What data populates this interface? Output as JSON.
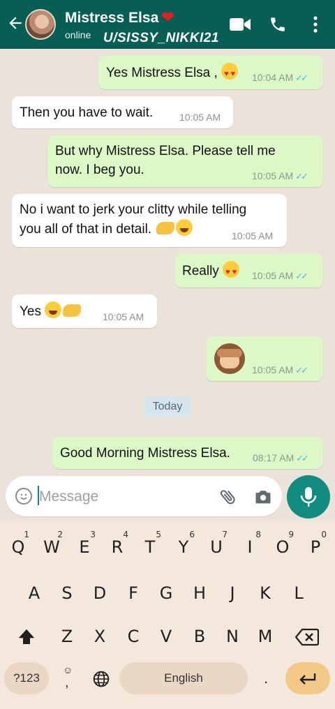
{
  "header": {
    "contact_name": "Mistress Elsa",
    "heart": "❤",
    "status": "online",
    "overlay_text": "U/SISSY_NIKKI21",
    "icons": [
      "back-arrow-icon",
      "avatar",
      "video-call-icon",
      "phone-icon",
      "more-options-icon"
    ]
  },
  "messages": [
    {
      "dir": "out",
      "text": "Yes Mistress Elsa ,",
      "emoji": "heart-eyes",
      "time": "10:04 AM"
    },
    {
      "dir": "in",
      "text": "Then you have to wait.",
      "time": "10:05 AM"
    },
    {
      "dir": "out",
      "line1": "But why Mistress Elsa. Please tell me",
      "line2": "now. I beg you.",
      "time": "10:05 AM"
    },
    {
      "dir": "in",
      "line1": "No i want to jerk your clitty while telling",
      "line2": "you all of that in detail.",
      "emoji": "pinching-hand, laughing",
      "time": "10:05 AM"
    },
    {
      "dir": "out",
      "text": "Really",
      "emoji": "heart-eyes",
      "time": "10:05 AM"
    },
    {
      "dir": "in",
      "text": "Yes",
      "emoji": "laughing, pinching-hand",
      "time": "10:05 AM"
    },
    {
      "dir": "out",
      "text": "",
      "emoji": "see-no-evil-monkey",
      "time": "10:05 AM"
    },
    {
      "dir": "out",
      "text": "Good Morning Mistress Elsa.",
      "time": "08:17 AM"
    }
  ],
  "date_divider": "Today",
  "composer": {
    "placeholder": "Message",
    "icons": [
      "emoji-icon",
      "attach-icon",
      "camera-icon",
      "mic-icon"
    ]
  },
  "keyboard": {
    "row1": [
      "Q",
      "W",
      "E",
      "R",
      "T",
      "Y",
      "U",
      "I",
      "O",
      "P"
    ],
    "row1_hints": [
      "1",
      "2",
      "3",
      "4",
      "5",
      "6",
      "7",
      "8",
      "9",
      "0"
    ],
    "row2": [
      "A",
      "S",
      "D",
      "F",
      "G",
      "H",
      "J",
      "K",
      "L"
    ],
    "row3": [
      "Z",
      "X",
      "C",
      "V",
      "B",
      "N",
      "M"
    ],
    "symbols_key": "?123",
    "comma_key": ",",
    "space_label": "English",
    "period_key": ".",
    "colors": {
      "enter_key": "#f2c986",
      "special_keys": "#ead7c4",
      "accent": "#128c7e"
    }
  }
}
